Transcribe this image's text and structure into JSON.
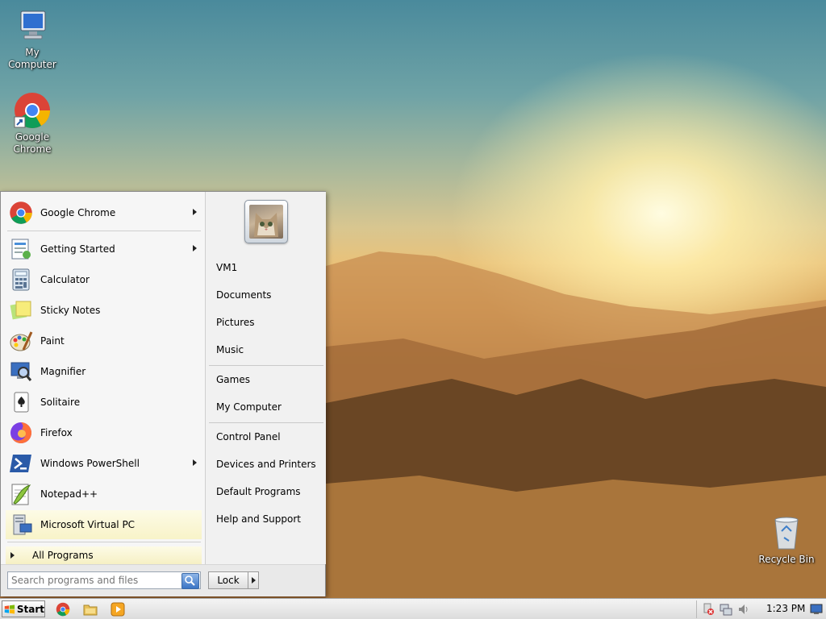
{
  "desktop": {
    "icons": [
      {
        "label": "My Computer"
      },
      {
        "label": "Google Chrome"
      },
      {
        "label": "Recycle Bin"
      }
    ]
  },
  "start_menu": {
    "pinned": [
      {
        "label": "Google Chrome",
        "icon": "chrome-icon"
      }
    ],
    "programs": [
      {
        "label": "Getting Started",
        "icon": "getting-started-icon"
      },
      {
        "label": "Calculator",
        "icon": "calculator-icon"
      },
      {
        "label": "Sticky Notes",
        "icon": "sticky-notes-icon"
      },
      {
        "label": "Paint",
        "icon": "paint-icon"
      },
      {
        "label": "Magnifier",
        "icon": "magnifier-icon"
      },
      {
        "label": "Solitaire",
        "icon": "solitaire-icon"
      },
      {
        "label": "Firefox",
        "icon": "firefox-icon"
      },
      {
        "label": "Windows PowerShell",
        "icon": "powershell-icon"
      },
      {
        "label": "Notepad++",
        "icon": "notepadpp-icon"
      },
      {
        "label": "Microsoft Virtual PC",
        "icon": "virtual-pc-icon"
      }
    ],
    "all_programs": "All Programs",
    "right_links": [
      {
        "label": "VM1"
      },
      {
        "label": "Documents"
      },
      {
        "label": "Pictures"
      },
      {
        "label": "Music"
      },
      {
        "label": "Games"
      },
      {
        "label": "My Computer"
      },
      {
        "label": "Control Panel"
      },
      {
        "label": "Devices and Printers"
      },
      {
        "label": "Default Programs"
      },
      {
        "label": "Help and Support"
      }
    ],
    "search": {
      "placeholder": "Search programs and files"
    },
    "lock_label": "Lock"
  },
  "taskbar": {
    "start_label": "Start",
    "clock": "1:23 PM"
  },
  "colors": {
    "menu_bg": "#f3f3f3",
    "hover_bg": "#f8f3c8",
    "taskbar_bg": "#e4e4e4"
  }
}
